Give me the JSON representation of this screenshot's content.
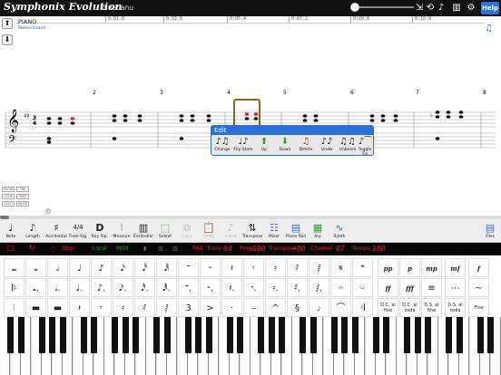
{
  "titlebar": {
    "app_title": "Symphonix Evolution",
    "user_name": "bluedanu",
    "help_label": "Help"
  },
  "timeline": {
    "marks": [
      "0:01.8",
      "0:03.6",
      "0:05.4",
      "0:07.2",
      "0:09.0",
      "0:10.8"
    ]
  },
  "track": {
    "name": "PIANO",
    "instrument": "Stereo Grand"
  },
  "measures": [
    "2",
    "3",
    "4",
    "5",
    "6",
    "7",
    "8"
  ],
  "side_buttons": [
    "SHOW",
    "TRK",
    "LOOP",
    "FREE",
    "SOLO",
    "MUTE"
  ],
  "edit_popup": {
    "title": "Edit",
    "items": [
      {
        "label": "Change",
        "icon": "♪♫"
      },
      {
        "label": "Flip Stem",
        "icon": "♩♪"
      },
      {
        "label": "Up",
        "icon": "⬆"
      },
      {
        "label": "Down",
        "icon": "⬇"
      },
      {
        "label": "Delete",
        "icon": "♫"
      },
      {
        "label": "Undo",
        "icon": "♪♪"
      },
      {
        "label": "Unbeam",
        "icon": "♫♫"
      },
      {
        "label": "Toggle Tie",
        "icon": "♪⁀"
      }
    ]
  },
  "toolbar": {
    "items": [
      {
        "label": "Note",
        "icon": "♩"
      },
      {
        "label": "Length",
        "icon": "♪"
      },
      {
        "label": "Accidental",
        "icon": "♯"
      },
      {
        "label": "Time Sig.",
        "icon": "4/4"
      },
      {
        "label": "Key Sig.",
        "icon": "D"
      },
      {
        "label": "Measure",
        "icon": "𝄀"
      },
      {
        "label": "Controller",
        "icon": "▥"
      },
      {
        "label": "Select",
        "icon": "⬚"
      },
      {
        "label": "Copy",
        "icon": "⧉"
      },
      {
        "label": "Paste",
        "icon": "📋"
      },
      {
        "label": "Insert",
        "icon": "♪"
      },
      {
        "label": "Transpose",
        "icon": "⇅"
      },
      {
        "label": "Mixer",
        "icon": "☷"
      },
      {
        "label": "Piano Roll",
        "icon": "▤"
      },
      {
        "label": "Arp",
        "icon": "▦"
      },
      {
        "label": "Synth",
        "icon": "∿"
      }
    ],
    "files_label": "Files"
  },
  "transport": {
    "stop_label": "Stop",
    "local_label": "Local",
    "midi_label": "MIDI",
    "pad_label": "PAD",
    "track_label": "Track",
    "track_value": "04",
    "prog_label": "Prog",
    "prog_value": "000",
    "transpose_label": "Transpose",
    "transpose_value": "+00",
    "channel_label": "Channel",
    "channel_value": "07",
    "tempo_label": "Tempo",
    "tempo_value": "180"
  },
  "palette_text": [
    "D.C. al fine",
    "D.C. al coda",
    "D.S. al fine",
    "D.S. al coda",
    "Fine"
  ],
  "dynamics": [
    "pp",
    "p",
    "mp",
    "mf",
    "f",
    "ff",
    "fff"
  ],
  "colors": {
    "accent": "#2a70d8",
    "selection": "#8b6914",
    "transport_text": "#e22222",
    "green": "#29a329"
  }
}
